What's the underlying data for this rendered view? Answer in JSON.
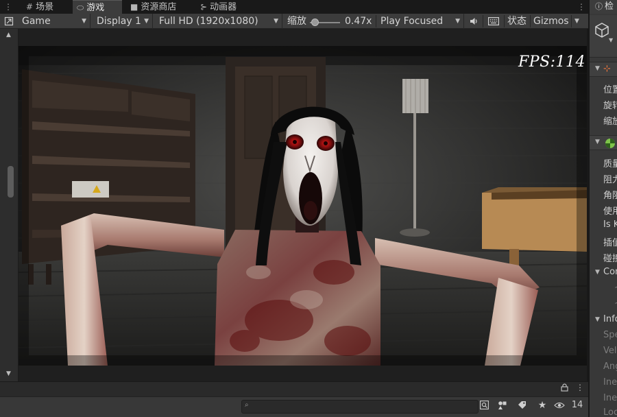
{
  "tabs": [
    {
      "label": "场景",
      "icon": "grid-icon"
    },
    {
      "label": "游戏",
      "icon": "gamepad-icon",
      "active": true
    },
    {
      "label": "资源商店",
      "icon": "store-bag-icon"
    },
    {
      "label": "动画器",
      "icon": "animator-icon"
    }
  ],
  "toolbar": {
    "view_type": "Game",
    "display": "Display 1",
    "resolution": "Full HD (1920x1080)",
    "scale_label": "缩放",
    "scale_value": "0.47x",
    "scale_level": 0.05,
    "play_mode": "Play Focused",
    "stats_label": "状态",
    "gizmos_label": "Gizmos"
  },
  "game_view": {
    "fps_text": "FPS:114"
  },
  "console": {
    "search_placeholder": "",
    "hidden_count": "14"
  },
  "inspector": {
    "tab_label": "检",
    "transform_rows": [
      "位置",
      "旋转",
      "缩放"
    ],
    "rigidbody_rows": [
      "质量",
      "阻力",
      "角阻",
      "使用",
      "Is K",
      "插值",
      "碰撞"
    ],
    "constraints_label": "Con",
    "info_label": "Info",
    "info_rows": [
      "Spe",
      "Vel",
      "Ang",
      "Ine",
      "Ine",
      "Loc"
    ]
  },
  "colors": {
    "editor_dark": "#191919",
    "toolbar_bg": "#3c3c3c",
    "panel_bg": "#383838",
    "fps_text": "#ffffff"
  }
}
